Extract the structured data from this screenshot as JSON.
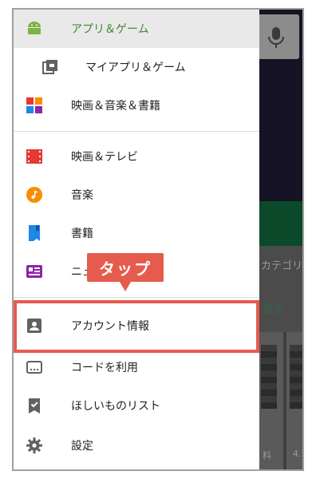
{
  "drawer": {
    "items": [
      {
        "label": "アプリ＆ゲーム",
        "icon": "android-icon",
        "active": true
      },
      {
        "label": "マイアプリ＆ゲーム",
        "icon": "library-icon"
      },
      {
        "label": "映画＆音楽＆書籍",
        "icon": "entertainment-icon"
      },
      {
        "label": "映画＆テレビ",
        "icon": "movie-icon"
      },
      {
        "label": "音楽",
        "icon": "music-icon"
      },
      {
        "label": "書籍",
        "icon": "book-icon"
      },
      {
        "label": "ニュース",
        "icon": "news-icon"
      },
      {
        "label": "アカウント情報",
        "icon": "account-icon"
      },
      {
        "label": "コードを利用",
        "icon": "redeem-icon"
      },
      {
        "label": "ほしいものリスト",
        "icon": "wishlist-icon"
      },
      {
        "label": "設定",
        "icon": "settings-icon"
      }
    ]
  },
  "callout": {
    "label": "タップ"
  },
  "background": {
    "category_text": "カテゴリ別",
    "see_more_text": "見る",
    "rating_a": "4.5",
    "rating_b": "料"
  },
  "colors": {
    "accent_green": "#3e8a2e",
    "callout_red": "#e55b4d"
  }
}
